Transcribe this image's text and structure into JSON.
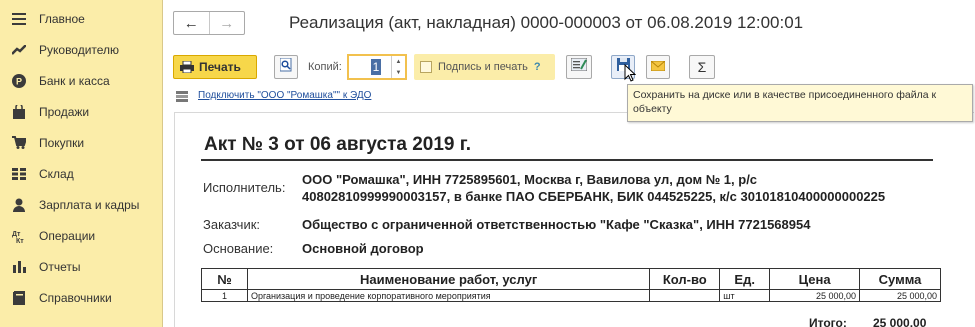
{
  "sidebar": {
    "items": [
      {
        "label": "Главное",
        "icon": "menu-icon"
      },
      {
        "label": "Руководителю",
        "icon": "chart-trend-icon"
      },
      {
        "label": "Банк и касса",
        "icon": "coin-icon"
      },
      {
        "label": "Продажи",
        "icon": "shopping-bag-icon"
      },
      {
        "label": "Покупки",
        "icon": "cart-icon"
      },
      {
        "label": "Склад",
        "icon": "warehouse-icon"
      },
      {
        "label": "Зарплата и кадры",
        "icon": "person-icon"
      },
      {
        "label": "Операции",
        "icon": "operations-icon"
      },
      {
        "label": "Отчеты",
        "icon": "bar-chart-icon"
      },
      {
        "label": "Справочники",
        "icon": "book-icon"
      }
    ]
  },
  "header": {
    "back": "←",
    "forward": "→",
    "title": "Реализация (акт, накладная) 0000-000003 от 06.08.2019 12:00:01"
  },
  "toolbar": {
    "print_label": "Печать",
    "copies_label": "Копий:",
    "copies_value": "1",
    "sign_label": "Подпись и печать",
    "sign_help": "?",
    "sum_symbol": "Σ"
  },
  "edo_link": "Подключить \"ООО \"Ромашка\"\" к ЭДО",
  "tooltip": "Сохранить на диске или в качестве присоединенного файла к объекту",
  "document": {
    "title": "Акт № 3 от 06 августа 2019 г.",
    "executor_label": "Исполнитель:",
    "executor_line1": "ООО \"Ромашка\", ИНН 7725895601, Москва г, Вавилова ул, дом № 1, р/с",
    "executor_line2": "40802810999990003157, в банке ПАО СБЕРБАНК, БИК 044525225, к/с 30101810400000000225",
    "customer_label": "Заказчик:",
    "customer_value": "Общество с ограниченной ответственностью \"Кафе \"Сказка\", ИНН 7721568954",
    "basis_label": "Основание:",
    "basis_value": "Основной договор",
    "table": {
      "headers": [
        "№",
        "Наименование работ, услуг",
        "Кол-во",
        "Ед.",
        "Цена",
        "Сумма"
      ],
      "rows": [
        [
          "1",
          "Организация и проведение корпоративного мероприятия",
          "",
          "шт",
          "25 000,00",
          "25 000,00"
        ]
      ]
    },
    "total_label": "Итого:",
    "total_value": "25 000,00"
  },
  "colors": {
    "sidebar_bg": "#fbeda9",
    "print_button": "#f7d74a",
    "tooltip_bg": "#fff9d6",
    "link": "#1f4e9c"
  }
}
